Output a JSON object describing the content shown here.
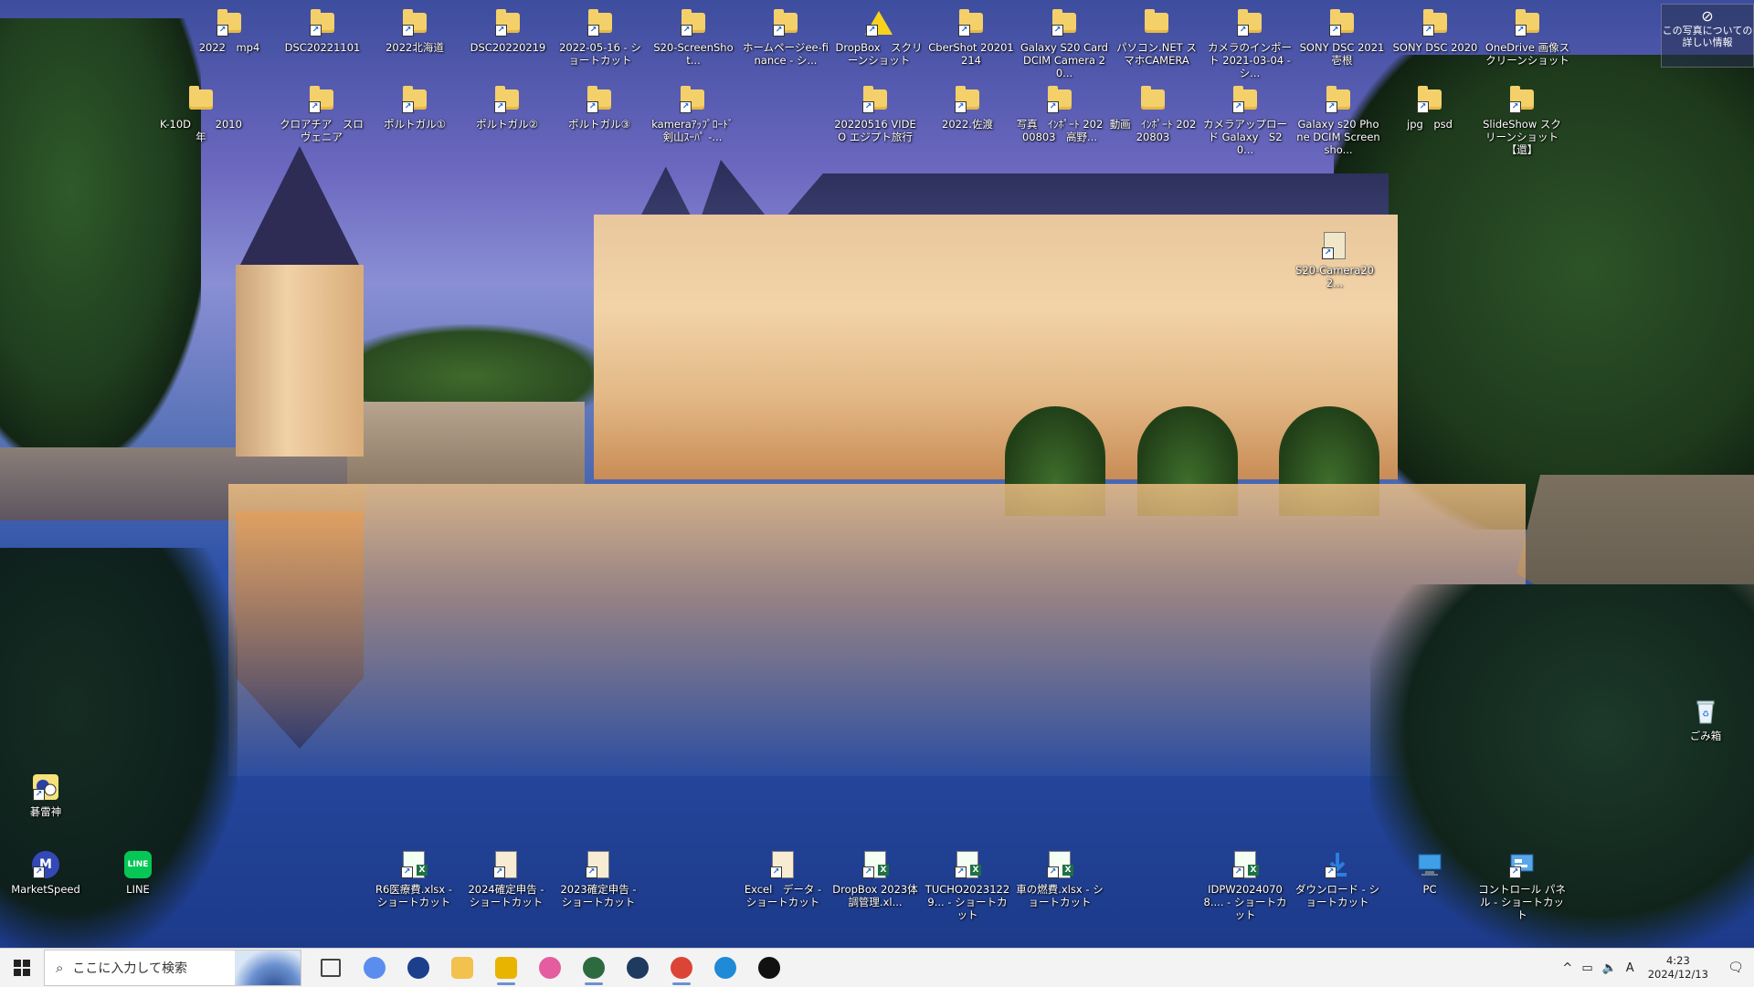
{
  "desktop_icons": {
    "row1": [
      {
        "label": "2022　mp4",
        "type": "folder-shortcut"
      },
      {
        "label": "DSC20221101",
        "type": "folder-shortcut"
      },
      {
        "label": "2022北海道",
        "type": "folder-shortcut"
      },
      {
        "label": "DSC20220219",
        "type": "folder-shortcut"
      },
      {
        "label": "2022-05-16 - ショートカット",
        "type": "folder-shortcut"
      },
      {
        "label": "S20-ScreenShot...",
        "type": "folder-shortcut"
      },
      {
        "label": "ホームページee-finance - シ...",
        "type": "folder-shortcut"
      },
      {
        "label": "DropBox　スクリーンショット",
        "type": "warning-shortcut"
      },
      {
        "label": "CberShot 20201214",
        "type": "folder-shortcut"
      },
      {
        "label": "Galaxy S20 Card DCIM Camera 20...",
        "type": "folder-shortcut"
      },
      {
        "label": "パソコン.NET スマホCAMERA",
        "type": "folder"
      },
      {
        "label": "カメラのインポート 2021-03-04 - シ...",
        "type": "folder-shortcut"
      },
      {
        "label": "SONY DSC 2021 壱根",
        "type": "folder-shortcut"
      },
      {
        "label": "SONY DSC 2020",
        "type": "folder-shortcut"
      },
      {
        "label": "OneDrive 画像スクリーンショット",
        "type": "folder-shortcut"
      }
    ],
    "row2": [
      {
        "label": "K-10D　　 2010年",
        "type": "folder"
      },
      {
        "label": "クロアチア　スロヴェニア",
        "type": "folder-shortcut"
      },
      {
        "label": "ポルトガル①",
        "type": "folder-shortcut"
      },
      {
        "label": "ポルトガル②",
        "type": "folder-shortcut"
      },
      {
        "label": "ポルトガル③",
        "type": "folder-shortcut"
      },
      {
        "label": "kameraｱｯﾌﾟﾛｰﾄﾞ 剣山ｽｰﾊﾟ -...",
        "type": "folder-shortcut"
      },
      {
        "label": "20220516 VIDEO エジプト旅行",
        "type": "folder-shortcut"
      },
      {
        "label": "2022.佐渡",
        "type": "folder-shortcut"
      },
      {
        "label": "写真　ｲﾝﾎﾟｰﾄ 20200803　高野...",
        "type": "folder-shortcut"
      },
      {
        "label": "動画　ｲﾝﾎﾟｰﾄ 20220803",
        "type": "folder"
      },
      {
        "label": "カメラアップロード Galaxy　S20...",
        "type": "folder-shortcut"
      },
      {
        "label": "Galaxy s20 Phone DCIM Screensho...",
        "type": "folder-shortcut"
      },
      {
        "label": "jpg　psd",
        "type": "folder-shortcut"
      },
      {
        "label": "SlideShow スクリーンショット 【還】",
        "type": "folder-shortcut"
      }
    ],
    "misc": {
      "s20camera": "S20-Camera202...",
      "recycle_bin": "ごみ箱",
      "app1": "碁雷神"
    },
    "bottom_row": [
      {
        "label": "MarketSpeed",
        "type": "app"
      },
      {
        "label": "LINE",
        "type": "line"
      },
      {
        "label": "R6医療費.xlsx - ショートカット",
        "type": "excel"
      },
      {
        "label": "2024確定申告 - ショートカット",
        "type": "doc"
      },
      {
        "label": "2023確定申告 - ショートカット",
        "type": "doc"
      },
      {
        "label": "Excel　データ - ショートカット",
        "type": "doc"
      },
      {
        "label": "DropBox 2023体調管理.xl...",
        "type": "excel"
      },
      {
        "label": "TUCHO20231229... - ショートカット",
        "type": "excel"
      },
      {
        "label": "車の燃費.xlsx - ショートカット",
        "type": "excel"
      },
      {
        "label": "IDPW20240708.... - ショートカット",
        "type": "excel"
      },
      {
        "label": "ダウンロード - ショートカット",
        "type": "download"
      },
      {
        "label": "PC",
        "type": "pc"
      },
      {
        "label": "コントロール パネル - ショートカット",
        "type": "control"
      }
    ]
  },
  "info_button": {
    "line1": "この写真についての",
    "line2": "詳しい情報"
  },
  "taskbar": {
    "search_placeholder": "ここに入力して検索",
    "apps": [
      {
        "name": "task-view",
        "color": "#444444"
      },
      {
        "name": "copilot",
        "color": "#5b8def"
      },
      {
        "name": "mt4",
        "color": "#1c3f8c"
      },
      {
        "name": "file-explorer",
        "color": "#f2c14e"
      },
      {
        "name": "sunflower-app",
        "color": "#e8b400"
      },
      {
        "name": "color-app",
        "color": "#e35da0"
      },
      {
        "name": "globe-app-1",
        "color": "#2d6a3f"
      },
      {
        "name": "globe-app-2",
        "color": "#1f3a5f"
      },
      {
        "name": "chrome",
        "color": "#db4437"
      },
      {
        "name": "edge",
        "color": "#1f8ad6"
      },
      {
        "name": "audio-app",
        "color": "#111111"
      }
    ],
    "tray": {
      "chevron": "^",
      "ime": "A",
      "time": "4:23",
      "date": "2024/12/13"
    }
  },
  "colors": {
    "taskbar_bg": "#f3f3f3",
    "folder": "#f4d06b",
    "excel": "#1e7145",
    "accent": "#6f8fd0"
  }
}
